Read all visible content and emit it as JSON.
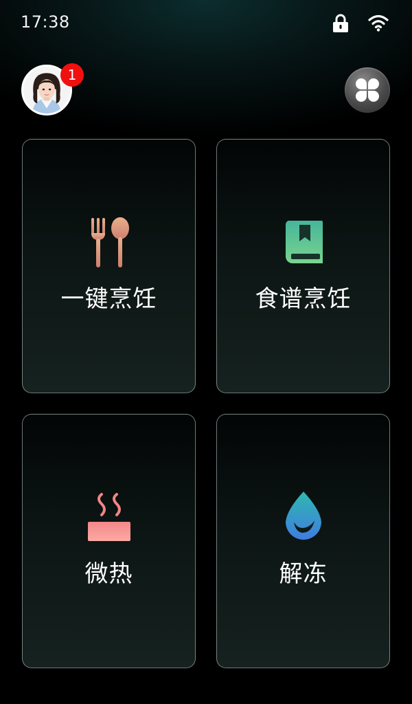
{
  "status_bar": {
    "time": "17:38",
    "icons": [
      "lock-icon",
      "wifi-icon"
    ]
  },
  "header": {
    "avatar_icon": "user-avatar",
    "notification_count": "1",
    "apps_icon": "four-petal-grid-icon"
  },
  "cards": [
    {
      "label": "一键烹饪",
      "icon": "fork-spoon-icon",
      "icon_color": "#d99379"
    },
    {
      "label": "食谱烹饪",
      "icon": "recipe-book-icon",
      "icon_color": "#5cc39a"
    },
    {
      "label": "微热",
      "icon": "steam-heat-icon",
      "icon_color": "#f47e80"
    },
    {
      "label": "解冻",
      "icon": "water-drop-icon",
      "icon_color": "#3a8fd6"
    }
  ],
  "colors": {
    "badge": "#f01010",
    "card_border": "#c8d7d7",
    "background_top": "#0c2d2e"
  }
}
